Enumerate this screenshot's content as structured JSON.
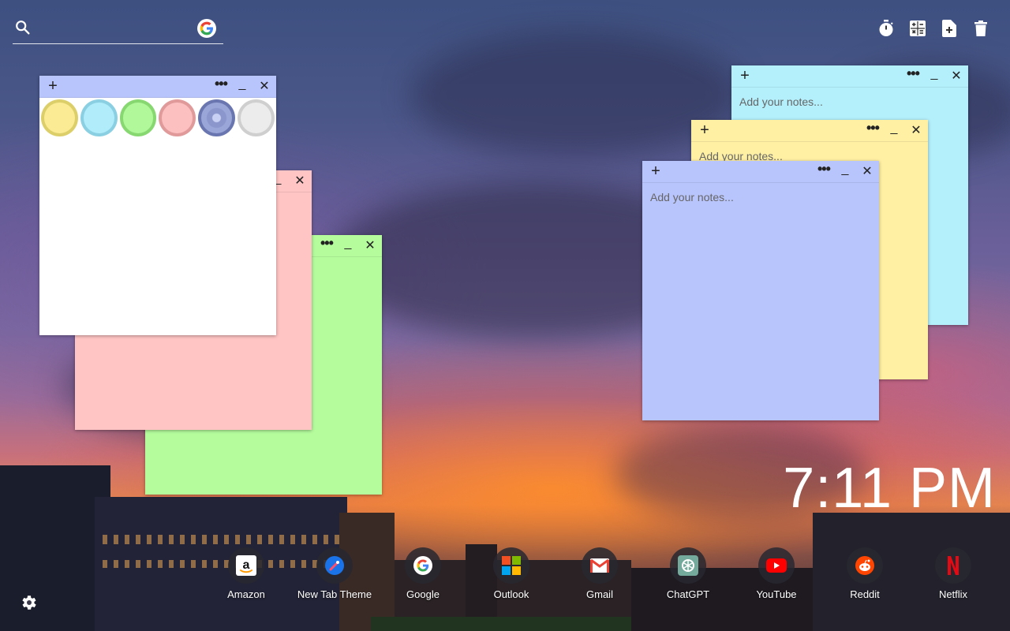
{
  "search": {
    "placeholder": "",
    "value": ""
  },
  "toolbar": {
    "icons": [
      "timer-icon",
      "calculator-icon",
      "new-note-icon",
      "trash-icon"
    ]
  },
  "notes": {
    "plus": "+",
    "dots": "•••",
    "minimize": "_",
    "close": "✕",
    "placeholder": "Add your notes...",
    "colors": {
      "white": "#ffffff",
      "pink": "#ffc4c4",
      "green": "#b4fc9c",
      "cyan": "#b4f0fc",
      "yellow": "#fff0a4",
      "periwinkle": "#b8c4fc",
      "periwinkle_bar": "#b8c4fc"
    }
  },
  "color_picker": {
    "swatches": [
      {
        "name": "yellow",
        "fill": "#fbeb94",
        "ring": "#dccf6a"
      },
      {
        "name": "cyan",
        "fill": "#b0ecfa",
        "ring": "#8ad0e2"
      },
      {
        "name": "green",
        "fill": "#b0f89a",
        "ring": "#88d872"
      },
      {
        "name": "pink",
        "fill": "#fcc0c0",
        "ring": "#e09a9a"
      },
      {
        "name": "periwinkle",
        "fill": "#8a96cc",
        "ring": "#6a76b0"
      },
      {
        "name": "gray",
        "fill": "#ececec",
        "ring": "#cfcfcf"
      }
    ]
  },
  "clock": {
    "time": "7:11 PM"
  },
  "shortcuts": [
    {
      "label": "Amazon",
      "icon": "amazon-icon"
    },
    {
      "label": "New Tab Theme",
      "icon": "new-tab-theme-icon"
    },
    {
      "label": "Google",
      "icon": "google-icon"
    },
    {
      "label": "Outlook",
      "icon": "outlook-icon"
    },
    {
      "label": "Gmail",
      "icon": "gmail-icon"
    },
    {
      "label": "ChatGPT",
      "icon": "chatgpt-icon"
    },
    {
      "label": "YouTube",
      "icon": "youtube-icon"
    },
    {
      "label": "Reddit",
      "icon": "reddit-icon"
    },
    {
      "label": "Netflix",
      "icon": "netflix-icon"
    }
  ],
  "settings": {
    "icon": "gear-icon"
  }
}
